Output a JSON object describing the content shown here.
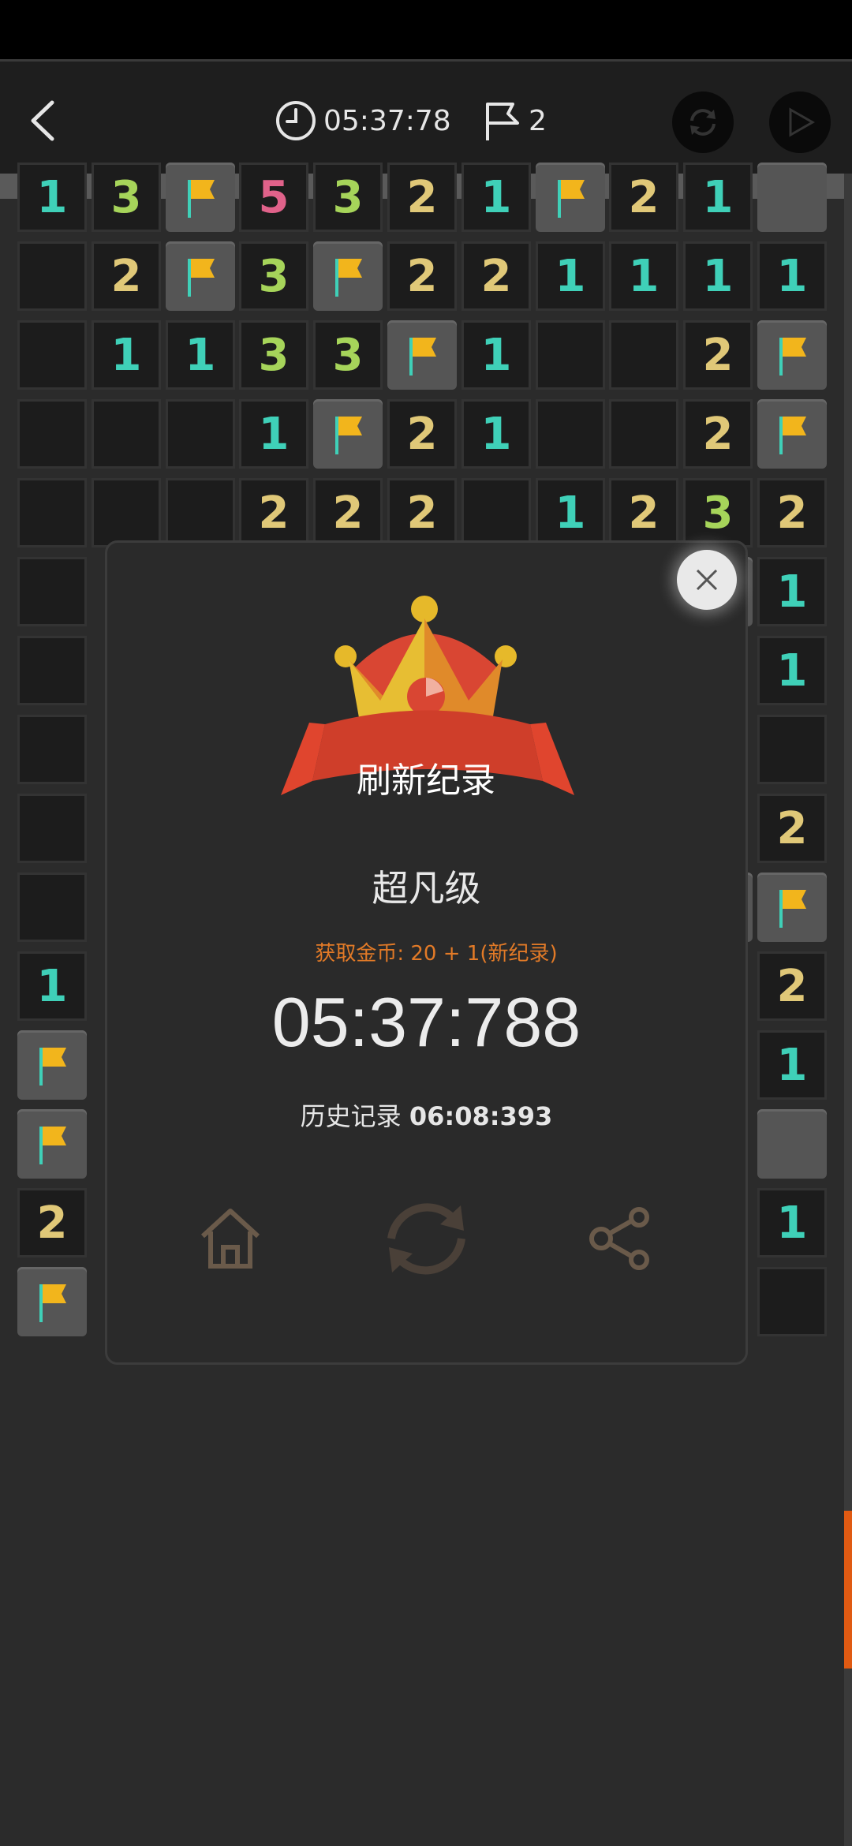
{
  "header": {
    "timer": "05:37:78",
    "flag_count": "2",
    "icons": [
      "back-arrow-icon",
      "clock-icon",
      "flag-icon",
      "refresh-icon",
      "play-icon"
    ]
  },
  "colors": {
    "n1": "#3fd0b8",
    "n2": "#e0c878",
    "n3": "#a6d45a",
    "n5": "#e0628a",
    "flag": "#f2b51c",
    "accent": "#e27a27"
  },
  "board": {
    "rows": [
      [
        "1",
        "3",
        "F",
        "5",
        "3",
        "2",
        "1",
        "F",
        "2",
        "1",
        "#"
      ],
      [
        "",
        "2",
        "F",
        "3",
        "F",
        "2",
        "2",
        "1",
        "1",
        "1",
        "1"
      ],
      [
        "",
        "1",
        "1",
        "3",
        "3",
        "F",
        "1",
        "",
        "",
        "2",
        "F"
      ],
      [
        "",
        "",
        "",
        "1",
        "F",
        "2",
        "1",
        "",
        "",
        "2",
        "F"
      ],
      [
        "",
        "",
        "",
        "2",
        "2",
        "2",
        "",
        "1",
        "2",
        "3",
        "2"
      ],
      [
        "",
        "?",
        "?",
        "?",
        "?",
        "?",
        "?",
        "?",
        "?",
        "#",
        "1"
      ],
      [
        "",
        "?",
        "?",
        "?",
        "?",
        "?",
        "?",
        "?",
        "?",
        "?",
        "1"
      ],
      [
        "",
        "?",
        "?",
        "?",
        "?",
        "?",
        "?",
        "?",
        "?",
        "?",
        ""
      ],
      [
        "",
        "?",
        "?",
        "?",
        "?",
        "?",
        "?",
        "?",
        "?",
        "?",
        "2"
      ],
      [
        "",
        "?",
        "?",
        "?",
        "?",
        "?",
        "?",
        "?",
        "?",
        "#",
        "F"
      ],
      [
        "1",
        "?",
        "?",
        "?",
        "?",
        "?",
        "?",
        "?",
        "?",
        "?",
        "2"
      ],
      [
        "F",
        "?",
        "?",
        "?",
        "?",
        "?",
        "?",
        "?",
        "?",
        "?",
        "1"
      ],
      [
        "F",
        "?",
        "?",
        "?",
        "?",
        "?",
        "?",
        "?",
        "?",
        "?",
        "#"
      ],
      [
        "2",
        "?",
        "?",
        "?",
        "?",
        "?",
        "?",
        "?",
        "?",
        "?",
        "1"
      ],
      [
        "F",
        "?",
        "?",
        "?",
        "?",
        "?",
        "?",
        "?",
        "?",
        "?",
        ""
      ]
    ]
  },
  "dialog": {
    "banner_text": "刷新纪录",
    "level": "超凡级",
    "coins": "获取金币: 20 + 1(新纪录)",
    "time": "05:37:788",
    "history_label": "历史记录",
    "history_value": "06:08:393",
    "actions": [
      "home-icon",
      "restart-icon",
      "share-icon"
    ]
  }
}
